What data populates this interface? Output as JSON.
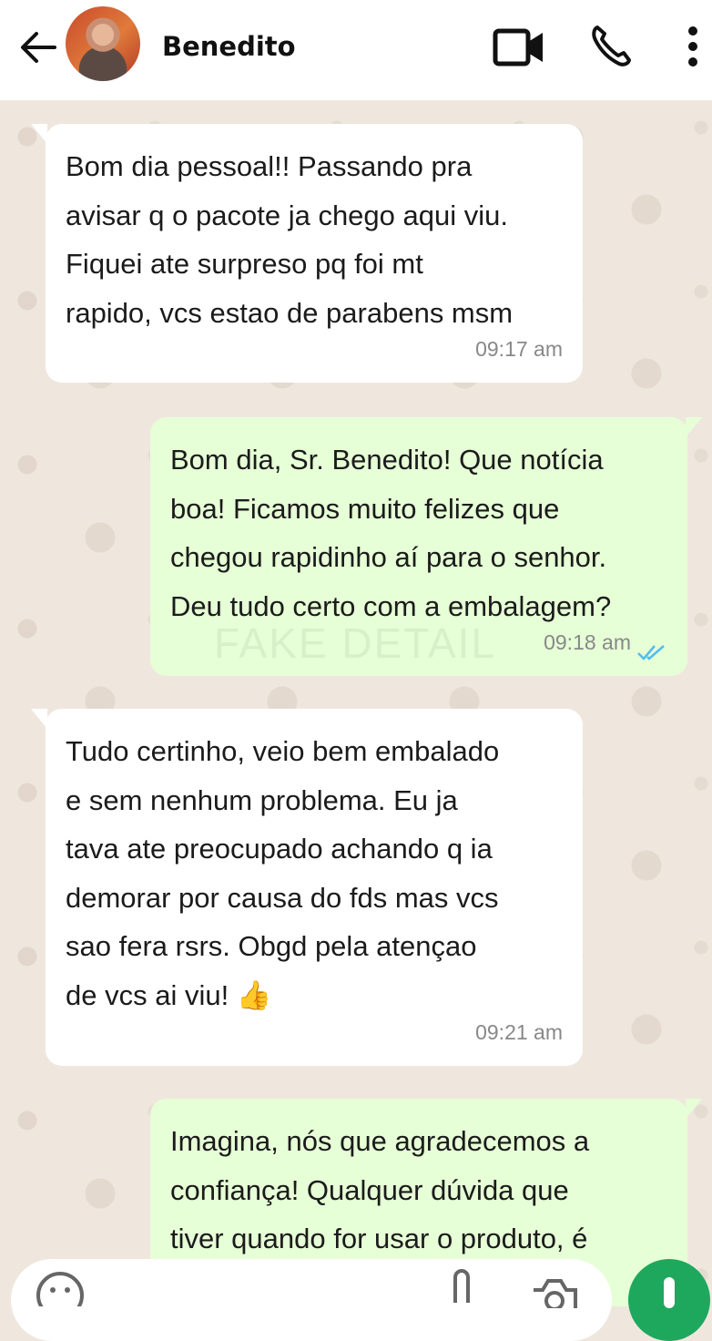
{
  "header": {
    "contact_name": "Benedito",
    "icons": [
      "back-arrow-icon",
      "avatar",
      "video-call-icon",
      "voice-call-icon",
      "more-options-icon"
    ]
  },
  "messages": [
    {
      "direction": "incoming",
      "text": "Bom dia pessoal!! Passando pra\navisar q o pacote ja chego aqui viu.\nFiquei ate surpreso pq foi mt\nrapido, vcs estao de parabens msm",
      "time": "09:17 am"
    },
    {
      "direction": "outgoing",
      "text": "Bom dia, Sr. Benedito! Que notícia\nboa! Ficamos muito felizes que\nchegou rapidinho aí para o senhor.\nDeu tudo certo com a embalagem?",
      "time": "09:18 am",
      "status": "read-double-check-icon",
      "watermark": "FAKE DETAIL"
    },
    {
      "direction": "incoming",
      "text": "Tudo certinho, veio bem embalado\ne sem nenhum problema. Eu ja\ntava ate preocupado achando q ia\ndemorar por causa do fds mas vcs\nsao fera rsrs. Obgd pela atençao\nde vcs ai viu! 👍",
      "time": "09:21 am"
    },
    {
      "direction": "outgoing",
      "text": "Imagina, nós que agradecemos a\nconfiança! Qualquer dúvida que\ntiver quando for usar o produto, é",
      "time": ""
    }
  ],
  "composer": {
    "icons": [
      "emoji-icon",
      "attach-icon",
      "camera-icon",
      "mic-icon"
    ]
  },
  "colors": {
    "incoming_bubble": "#ffffff",
    "outgoing_bubble": "#e6ffd6",
    "read_tick": "#53bdeb",
    "mic_button": "#1ea85d"
  }
}
